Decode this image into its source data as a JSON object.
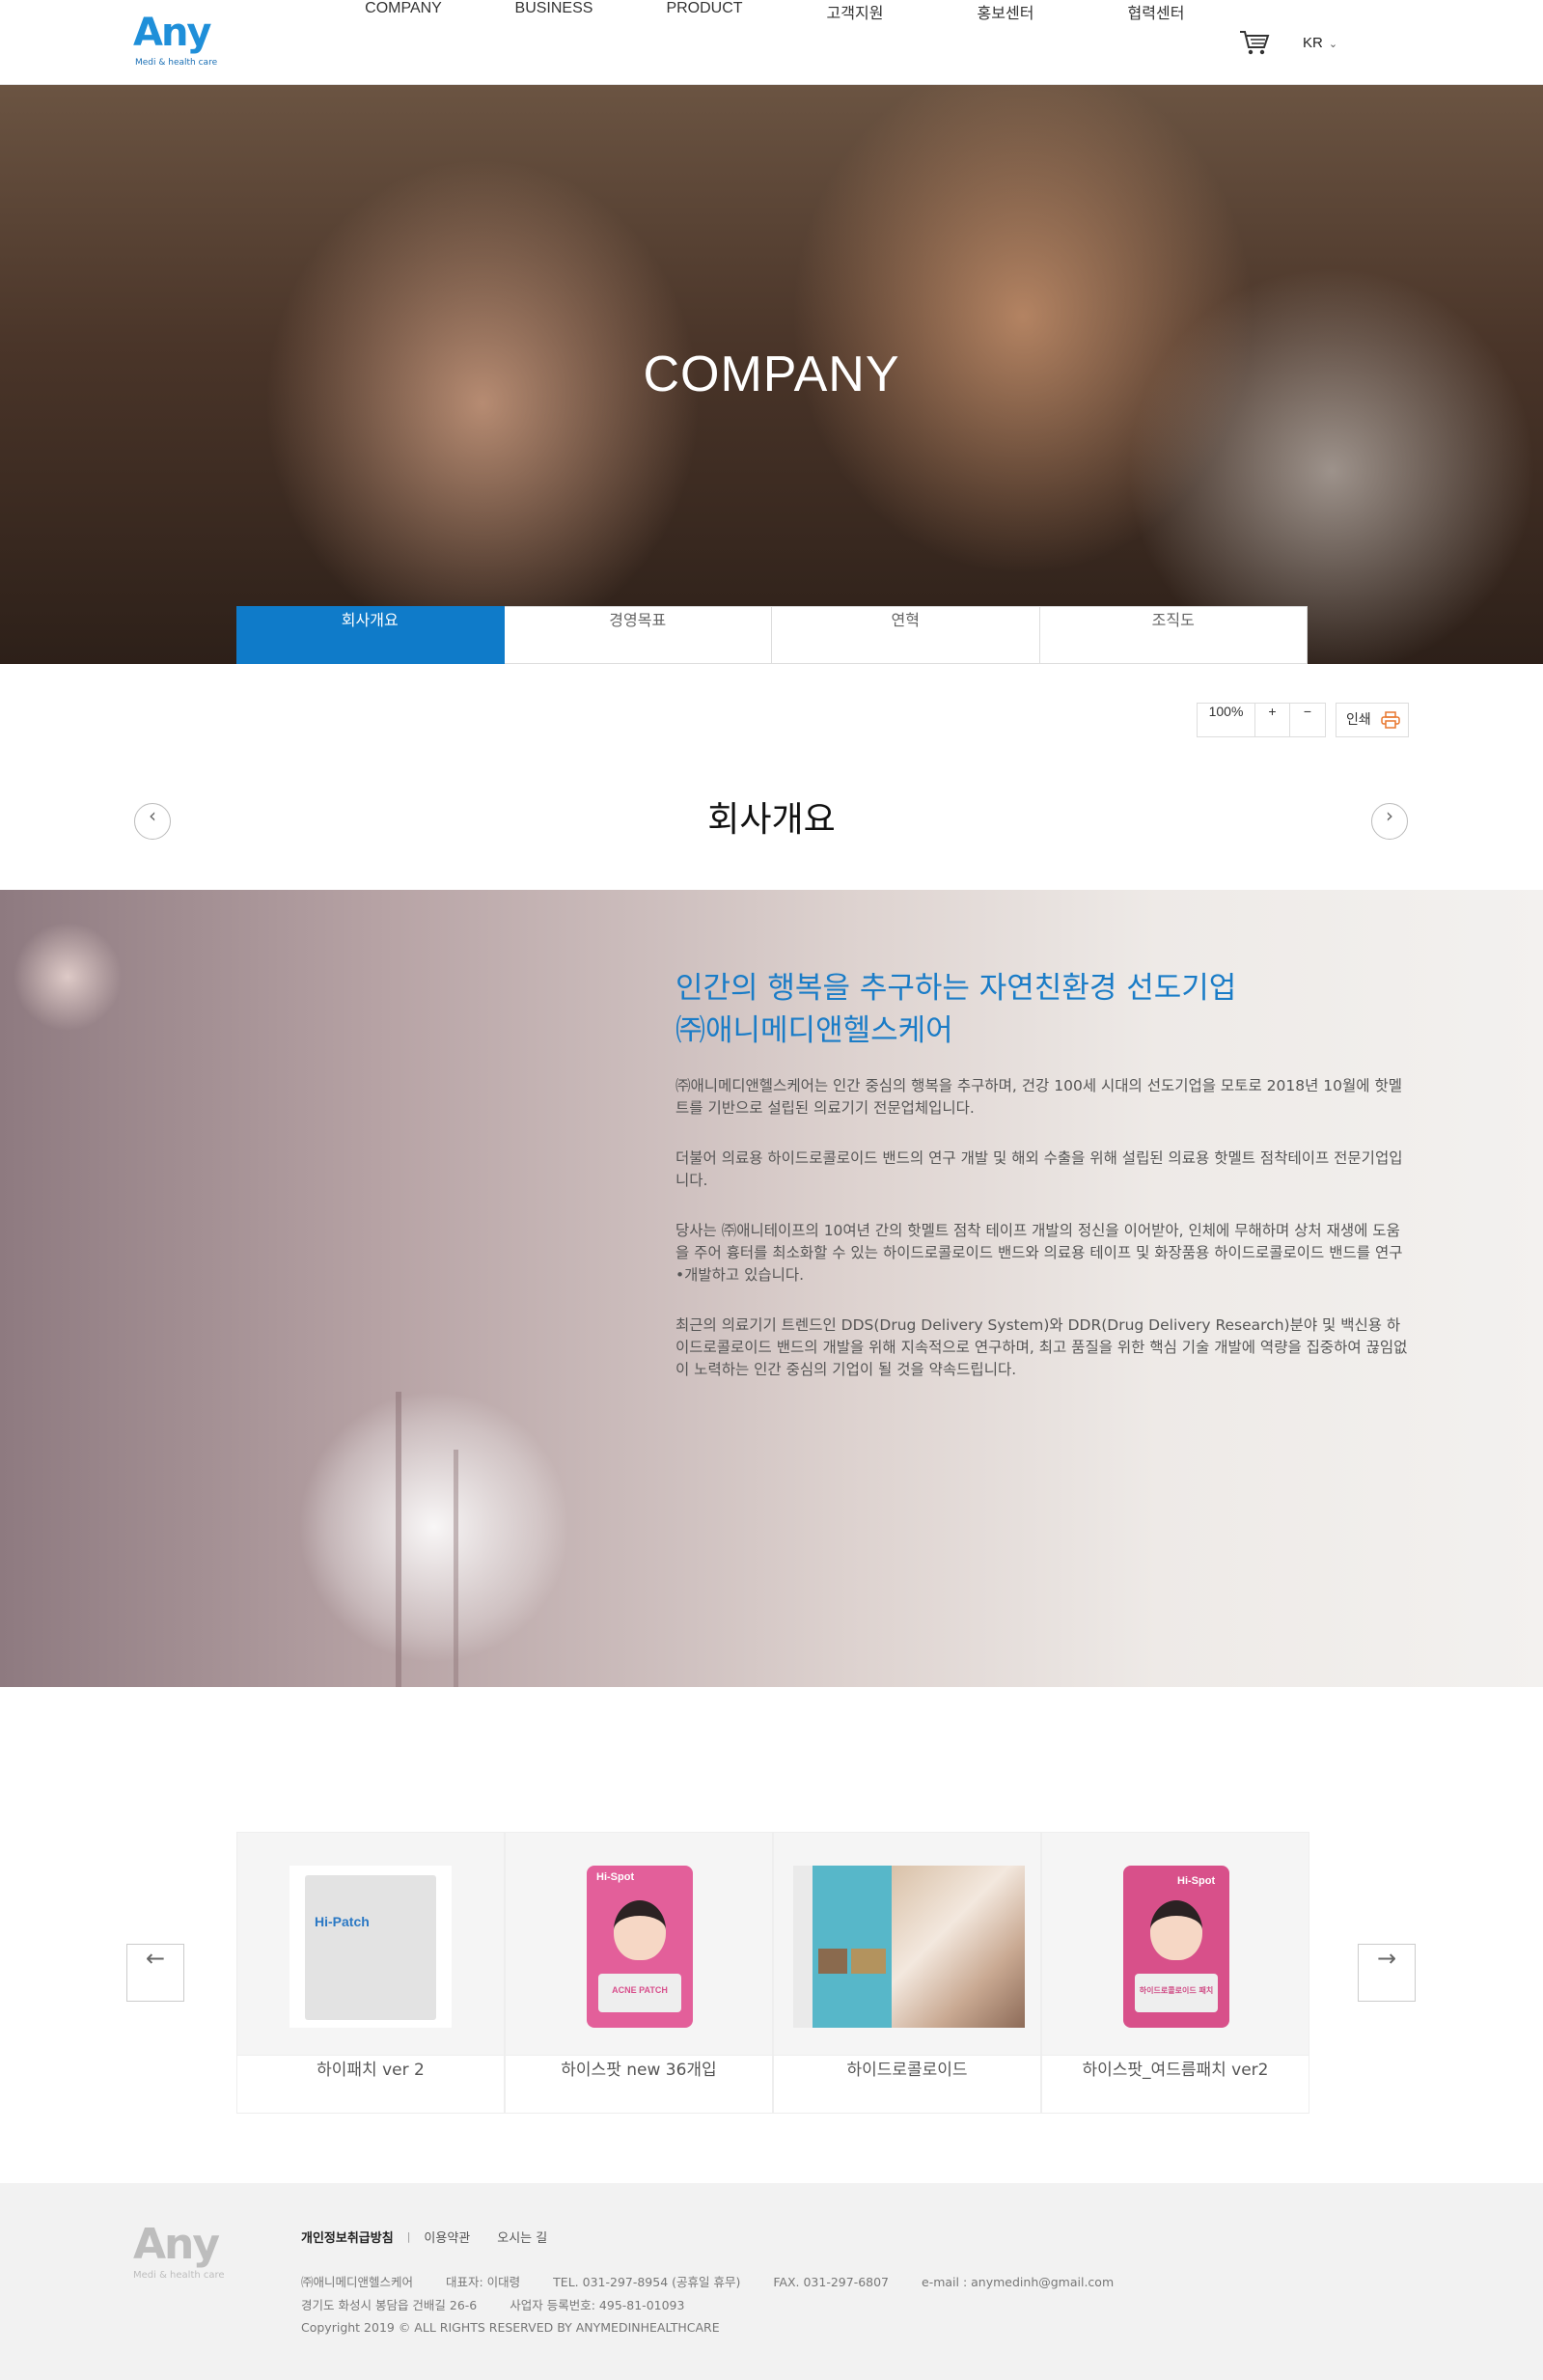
{
  "header": {
    "logo_text": "Any",
    "logo_sub": "Medi & health care",
    "nav": [
      "COMPANY",
      "BUSINESS",
      "PRODUCT",
      "고객지원",
      "홍보센터",
      "협력센터"
    ],
    "lang": "KR"
  },
  "hero": {
    "title": "COMPANY",
    "tabs": [
      "회사개요",
      "경영목표",
      "연혁",
      "조직도"
    ]
  },
  "tools": {
    "zoom_value": "100%",
    "zoom_in": "+",
    "zoom_out": "−",
    "print_label": "인쇄"
  },
  "section": {
    "title": "회사개요"
  },
  "intro": {
    "heading_line1": "인간의 행복을 추구하는 자연친환경 선도기업",
    "heading_line2": "㈜애니메디앤헬스케어",
    "p1": "㈜애니메디앤헬스케어는 인간 중심의 행복을 추구하며, 건강 100세 시대의 선도기업을 모토로 2018년 10월에 핫멜트를 기반으로 설립된 의료기기 전문업체입니다.",
    "p2": "더불어 의료용 하이드로콜로이드 밴드의 연구 개발 및 해외 수출을 위해 설립된 의료용 핫멜트 점착테이프 전문기업입니다.",
    "p3": "당사는 ㈜애니테이프의 10여년 간의 핫멜트 점착 테이프 개발의 정신을 이어받아, 인체에 무해하며 상처 재생에 도움을 주어 흉터를 최소화할 수 있는 하이드로콜로이드 밴드와 의료용 테이프 및 화장품용 하이드로콜로이드 밴드를 연구•개발하고 있습니다.",
    "p4": "최근의 의료기기 트렌드인 DDS(Drug Delivery System)와 DDR(Drug Delivery Research)분야 및 백신용 하이드로콜로이드 밴드의 개발을 위해 지속적으로 연구하며, 최고 품질을 위한 핵심 기술 개발에 역량을 집중하여 끊임없이 노력하는 인간 중심의 기업이 될 것을 약속드립니다."
  },
  "products": [
    {
      "name": "하이패치 ver 2",
      "pack_brand": "Hi-Patch",
      "color": "#e6e6e6"
    },
    {
      "name": "하이스팟 new 36개입",
      "pack_brand": "Hi-Spot",
      "pack_text": "ACNE PATCH",
      "color": "#e0609a"
    },
    {
      "name": "하이드로콜로이드",
      "color": "#57b7c9"
    },
    {
      "name": "하이스팟_여드름패치 ver2",
      "pack_brand": "Hi-Spot",
      "pack_text": "하이드로콜로이드 패치",
      "color": "#d8508a"
    }
  ],
  "footer": {
    "logo_text": "Any",
    "logo_sub": "Medi & health care",
    "links": [
      "개인정보취급방침",
      "이용약관",
      "오시는 길"
    ],
    "company": "㈜애니메디앤헬스케어",
    "ceo": "대표자: 이대령",
    "tel": "TEL. 031-297-8954 (공휴일 휴무)",
    "fax": "FAX. 031-297-6807",
    "email": "e-mail : anymedinh@gmail.com",
    "address": "경기도 화성시 봉담읍 건배길 26-6",
    "bizno": "사업자 등록번호: 495-81-01093",
    "copyright": "Copyright 2019 © ALL RIGHTS RESERVED BY ANYMEDINHEALTHCARE"
  }
}
